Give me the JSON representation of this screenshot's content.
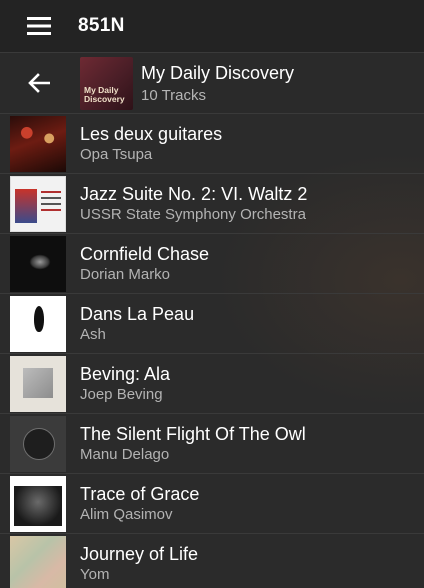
{
  "header": {
    "app_title": "851N",
    "menu_icon": "hamburger-menu-icon"
  },
  "playlist": {
    "back_icon": "arrow-left-icon",
    "cover_text": "My Daily Discovery",
    "title": "My Daily Discovery",
    "subtitle": "10 Tracks"
  },
  "tracks": [
    {
      "title": "Les deux guitares",
      "artist": "Opa Tsupa"
    },
    {
      "title": "Jazz Suite No. 2: VI. Waltz 2",
      "artist": "USSR State Symphony Orchestra"
    },
    {
      "title": "Cornfield Chase",
      "artist": "Dorian Marko"
    },
    {
      "title": "Dans La Peau",
      "artist": "Ash"
    },
    {
      "title": "Beving: Ala",
      "artist": "Joep Beving"
    },
    {
      "title": "The Silent Flight Of The Owl",
      "artist": "Manu Delago"
    },
    {
      "title": "Trace of Grace",
      "artist": "Alim Qasimov"
    },
    {
      "title": "Journey of Life",
      "artist": "Yom"
    }
  ],
  "colors": {
    "background": "#2b2b2b",
    "topbar": "#232323",
    "divider": "#3a3a3a",
    "primary_text": "#ffffff",
    "secondary_text": "#b3b3b3"
  }
}
